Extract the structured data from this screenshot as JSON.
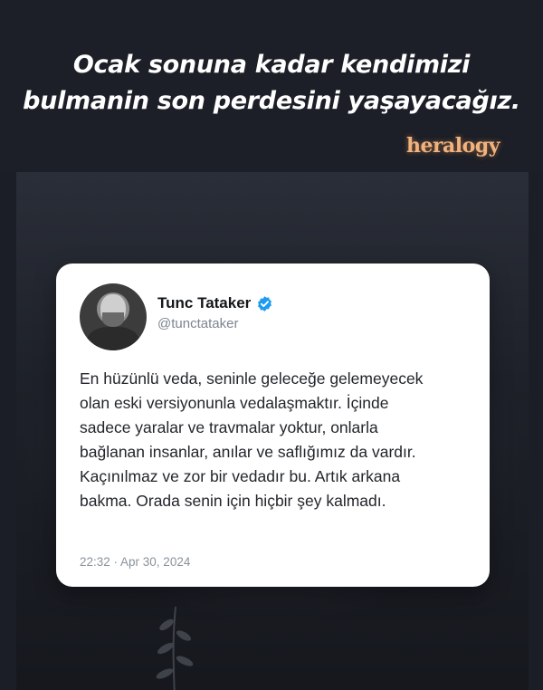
{
  "headline": {
    "line1": "Ocak sonuna kadar kendimizi",
    "line2": "bulmanin son perdesini yaşayacağız."
  },
  "brand": "heralogy",
  "tweet": {
    "author_name": "Tunc Tataker",
    "handle": "@tunctataker",
    "verified": true,
    "lines": [
      "En hüzünlü veda, seninle geleceğe gelemeyecek",
      "olan eski versiyonunla vedalaşmaktır. İçinde",
      "sadece yaralar ve travmalar yoktur, onlarla",
      "bağlanan insanlar, anılar ve saflığımız da vardır.",
      "Kaçınılmaz ve zor bir vedadır bu. Artık arkana",
      "bakma. Orada senin için hiçbir şey kalmadı."
    ],
    "timestamp": "22:32 · Apr 30, 2024"
  },
  "icons": {
    "verified": "verified-badge-icon",
    "avatar": "profile-photo"
  },
  "colors": {
    "background": "#1b1e26",
    "brand": "#f0b37e",
    "verified": "#1d9bf0"
  }
}
